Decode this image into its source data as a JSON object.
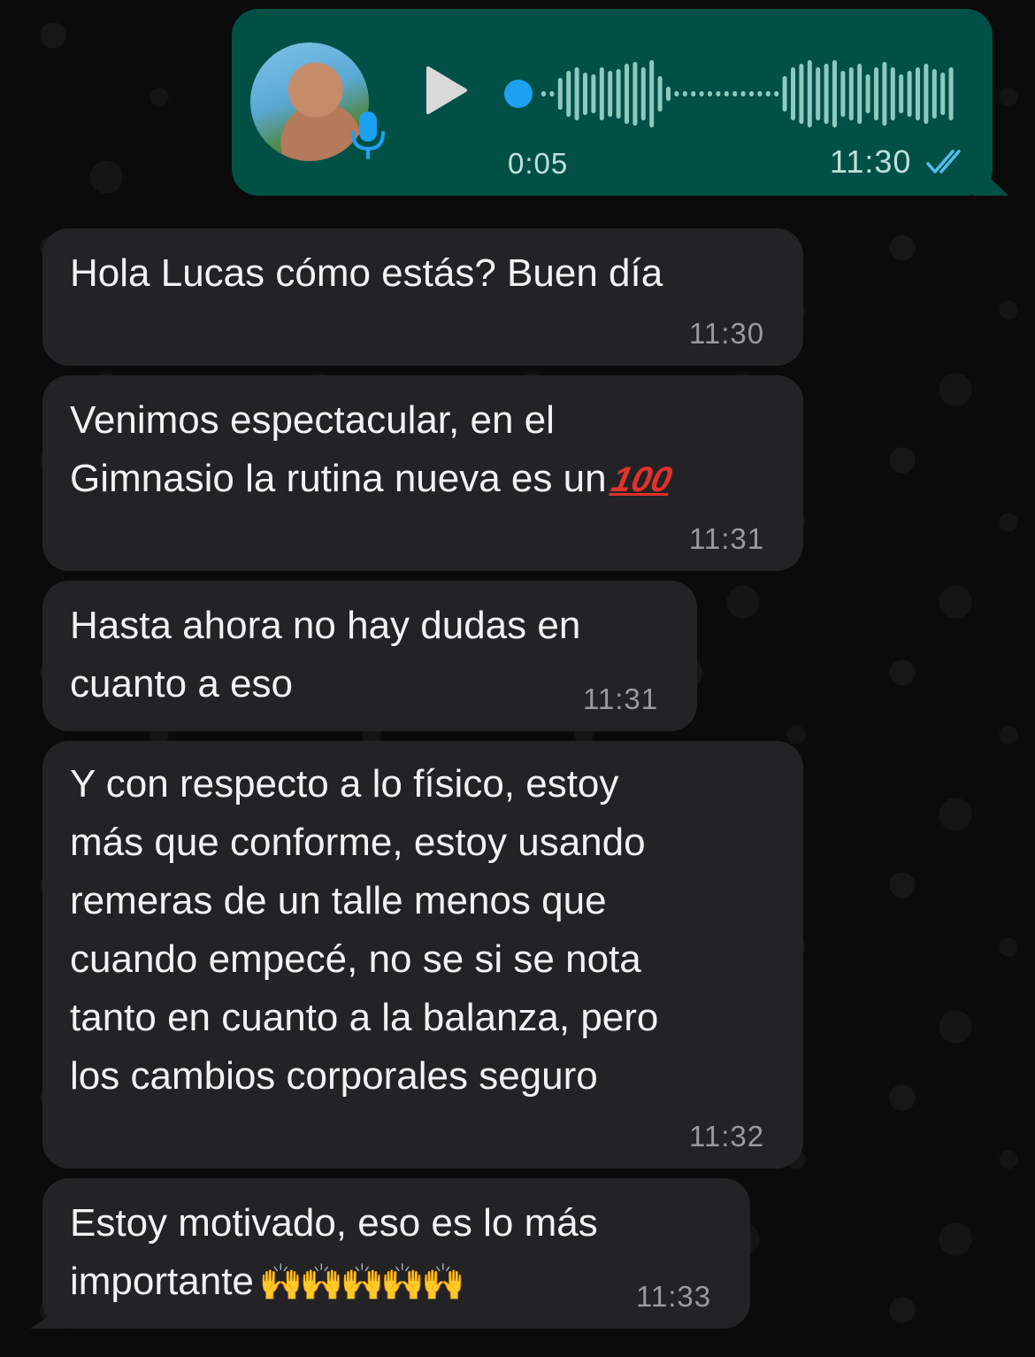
{
  "voice_note": {
    "duration": "0:05",
    "time": "11:30",
    "status": "read",
    "avatar_icon": "contact-photo",
    "mic_icon": "mic-icon",
    "play_icon": "play-icon",
    "colors": {
      "bubble": "#005046",
      "accent": "#1da1f2",
      "wave": "#8fc9bd"
    }
  },
  "messages": [
    {
      "text": "Hola Lucas cómo estás? Buen día",
      "time": "11:30"
    },
    {
      "text": "Venimos espectacular, en el\nGimnasio la rutina nueva es un",
      "emoji": "100",
      "time": "11:31"
    },
    {
      "text": "Hasta ahora no hay dudas en\ncuanto a eso",
      "time": "11:31"
    },
    {
      "text": "Y con respecto a lo físico, estoy\nmás que conforme, estoy usando\nremeras de un talle menos que\ncuando empecé, no se si se nota\ntanto en cuanto a la balanza, pero\nlos cambios corporales seguro",
      "time": "11:32"
    },
    {
      "text": "Estoy motivado, eso es lo más\nimportante",
      "emoji": "🙌🙌🙌🙌🙌",
      "time": "11:33"
    }
  ],
  "colors": {
    "incoming_bubble": "#232325",
    "background": "#0b0b0b",
    "time_text": "#9a9a9c"
  }
}
